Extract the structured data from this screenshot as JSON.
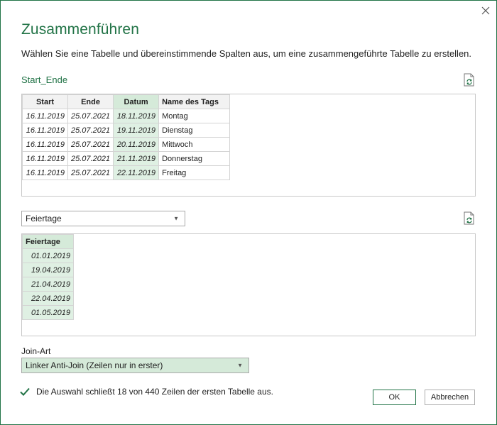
{
  "dialog": {
    "title": "Zusammenführen",
    "subtitle": "Wählen Sie eine Tabelle und übereinstimmende Spalten aus, um eine zusammengeführte Tabelle zu erstellen.",
    "close_icon": "close-icon"
  },
  "first_table": {
    "name": "Start_Ende",
    "columns": [
      "Start",
      "Ende",
      "Datum",
      "Name des Tags"
    ],
    "selected_column": "Datum",
    "rows": [
      [
        "16.11.2019",
        "25.07.2021",
        "18.11.2019",
        "Montag"
      ],
      [
        "16.11.2019",
        "25.07.2021",
        "19.11.2019",
        "Dienstag"
      ],
      [
        "16.11.2019",
        "25.07.2021",
        "20.11.2019",
        "Mittwoch"
      ],
      [
        "16.11.2019",
        "25.07.2021",
        "21.11.2019",
        "Donnerstag"
      ],
      [
        "16.11.2019",
        "25.07.2021",
        "22.11.2019",
        "Freitag"
      ]
    ]
  },
  "second_table": {
    "selected": "Feiertage",
    "columns": [
      "Feiertage"
    ],
    "rows": [
      [
        "01.01.2019"
      ],
      [
        "19.04.2019"
      ],
      [
        "21.04.2019"
      ],
      [
        "22.04.2019"
      ],
      [
        "01.05.2019"
      ]
    ]
  },
  "join": {
    "label": "Join-Art",
    "selected": "Linker Anti-Join (Zeilen nur in erster)"
  },
  "status": {
    "text": "Die Auswahl schließt 18 von 440 Zeilen der ersten Tabelle aus."
  },
  "buttons": {
    "ok": "OK",
    "cancel": "Abbrechen"
  },
  "colors": {
    "accent": "#217346",
    "selected_column": "#dff0e3"
  }
}
